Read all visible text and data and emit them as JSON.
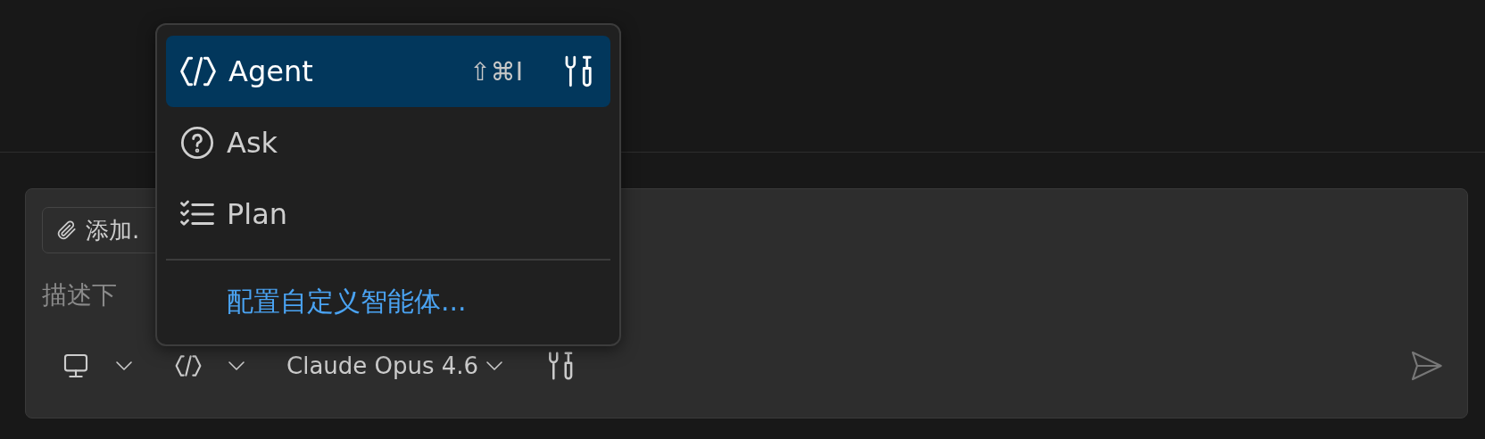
{
  "composer": {
    "context_chip": "添加.",
    "placeholder": "描述下",
    "model": "Claude Opus 4.6"
  },
  "mode_menu": {
    "items": [
      {
        "label": "Agent",
        "shortcut": "⇧⌘I",
        "selected": true
      },
      {
        "label": "Ask",
        "selected": false
      },
      {
        "label": "Plan",
        "selected": false
      }
    ],
    "link": "配置自定义智能体..."
  }
}
